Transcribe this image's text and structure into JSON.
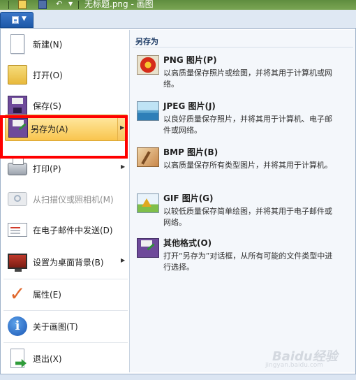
{
  "window": {
    "title": "无标题.png - 画图"
  },
  "menu_button": {
    "name": "paint-menu"
  },
  "menu": {
    "items": [
      {
        "label": "新建(N)",
        "icon": "new-document-icon"
      },
      {
        "label": "打开(O)",
        "icon": "open-folder-icon"
      },
      {
        "label": "保存(S)",
        "icon": "save-disk-icon"
      },
      {
        "label": "另存为(A)",
        "icon": "save-as-icon",
        "has_submenu": true,
        "selected": true
      },
      {
        "label": "打印(P)",
        "icon": "printer-icon",
        "has_submenu": true
      },
      {
        "label": "从扫描仪或照相机(M)",
        "icon": "scanner-camera-icon",
        "disabled": true
      },
      {
        "label": "在电子邮件中发送(D)",
        "icon": "email-icon"
      },
      {
        "label": "设置为桌面背景(B)",
        "icon": "desktop-background-icon",
        "has_submenu": true
      },
      {
        "label": "属性(E)",
        "icon": "checkmark-icon"
      },
      {
        "label": "关于画图(T)",
        "icon": "info-icon"
      },
      {
        "label": "退出(X)",
        "icon": "exit-icon"
      }
    ]
  },
  "submenu": {
    "header": "另存为",
    "items": [
      {
        "title": "PNG 图片(P)",
        "desc": "以高质量保存照片或绘图，并将其用于计算机或网络。",
        "icon": "png-picture-icon"
      },
      {
        "title": "JPEG 图片(J)",
        "desc": "以良好质量保存照片，并将其用于计算机、电子邮件或网络。",
        "icon": "jpeg-picture-icon"
      },
      {
        "title": "BMP 图片(B)",
        "desc": "以高质量保存所有类型图片，并将其用于计算机。",
        "icon": "bmp-picture-icon"
      },
      {
        "title": "GIF 图片(G)",
        "desc": "以较低质量保存简单绘图，并将其用于电子邮件或网络。",
        "icon": "gif-picture-icon"
      },
      {
        "title": "其他格式(O)",
        "desc": "打开“另存为”对话框，从所有可能的文件类型中进行选择。",
        "icon": "other-formats-icon"
      }
    ]
  },
  "watermark": {
    "text": "Baidu经验",
    "sub": "jingyan.baidu.com"
  },
  "colors": {
    "highlight_box": "#ff0000",
    "selected_item": "#fcd879",
    "title_bar": "#6a9847"
  }
}
